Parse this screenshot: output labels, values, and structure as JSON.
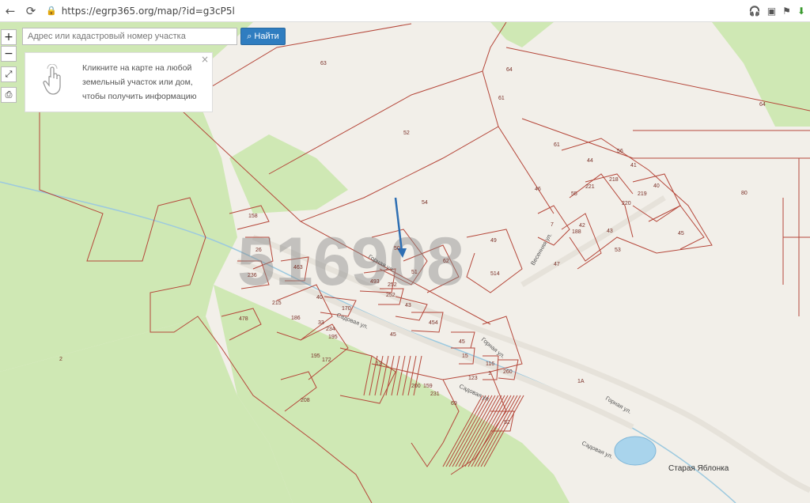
{
  "browser": {
    "url": "https://egrp365.org/map/?id=g3cP5l",
    "back_icon": "←",
    "reload_icon": "⟳"
  },
  "map_controls": {
    "zoom_in": "+",
    "zoom_out": "−"
  },
  "search": {
    "placeholder": "Адрес или кадастровый номер участка",
    "button_label": "Найти"
  },
  "info_popup": {
    "text": "Кликните на карте на любой земельный участок или дом, чтобы получить информацию",
    "close": "×"
  },
  "watermark": "516908",
  "place_label": "Старая Яблонка",
  "parcel_labels": [
    "63",
    "64",
    "64",
    "61",
    "52",
    "61",
    "44",
    "56",
    "41",
    "218",
    "221",
    "40",
    "55",
    "219",
    "220",
    "80",
    "54",
    "46",
    "158",
    "45",
    "43",
    "42",
    "188",
    "53",
    "49",
    "50",
    "62",
    "7",
    "26",
    "47",
    "51",
    "514",
    "463",
    "236",
    "493",
    "252",
    "40",
    "252",
    "43",
    "170",
    "215",
    "454",
    "478",
    "186",
    "33",
    "234",
    "195",
    "195",
    "45",
    "45",
    "15",
    "172",
    "13",
    "116",
    "1",
    "123",
    "200",
    "231",
    "260",
    "159",
    "69",
    "208",
    "52",
    "1A",
    "2"
  ],
  "street_labels": [
    "Горная ул.",
    "Садовая ул.",
    "Горная ул.",
    "Садовая ул.",
    "Горная ул.",
    "Садовая ул.",
    "Весенняя ул."
  ],
  "colors": {
    "forest": "#cfe8b4",
    "parcel_line": "#b5473a",
    "search_button": "#2f7dc0",
    "arrow": "#2e6fb3"
  }
}
